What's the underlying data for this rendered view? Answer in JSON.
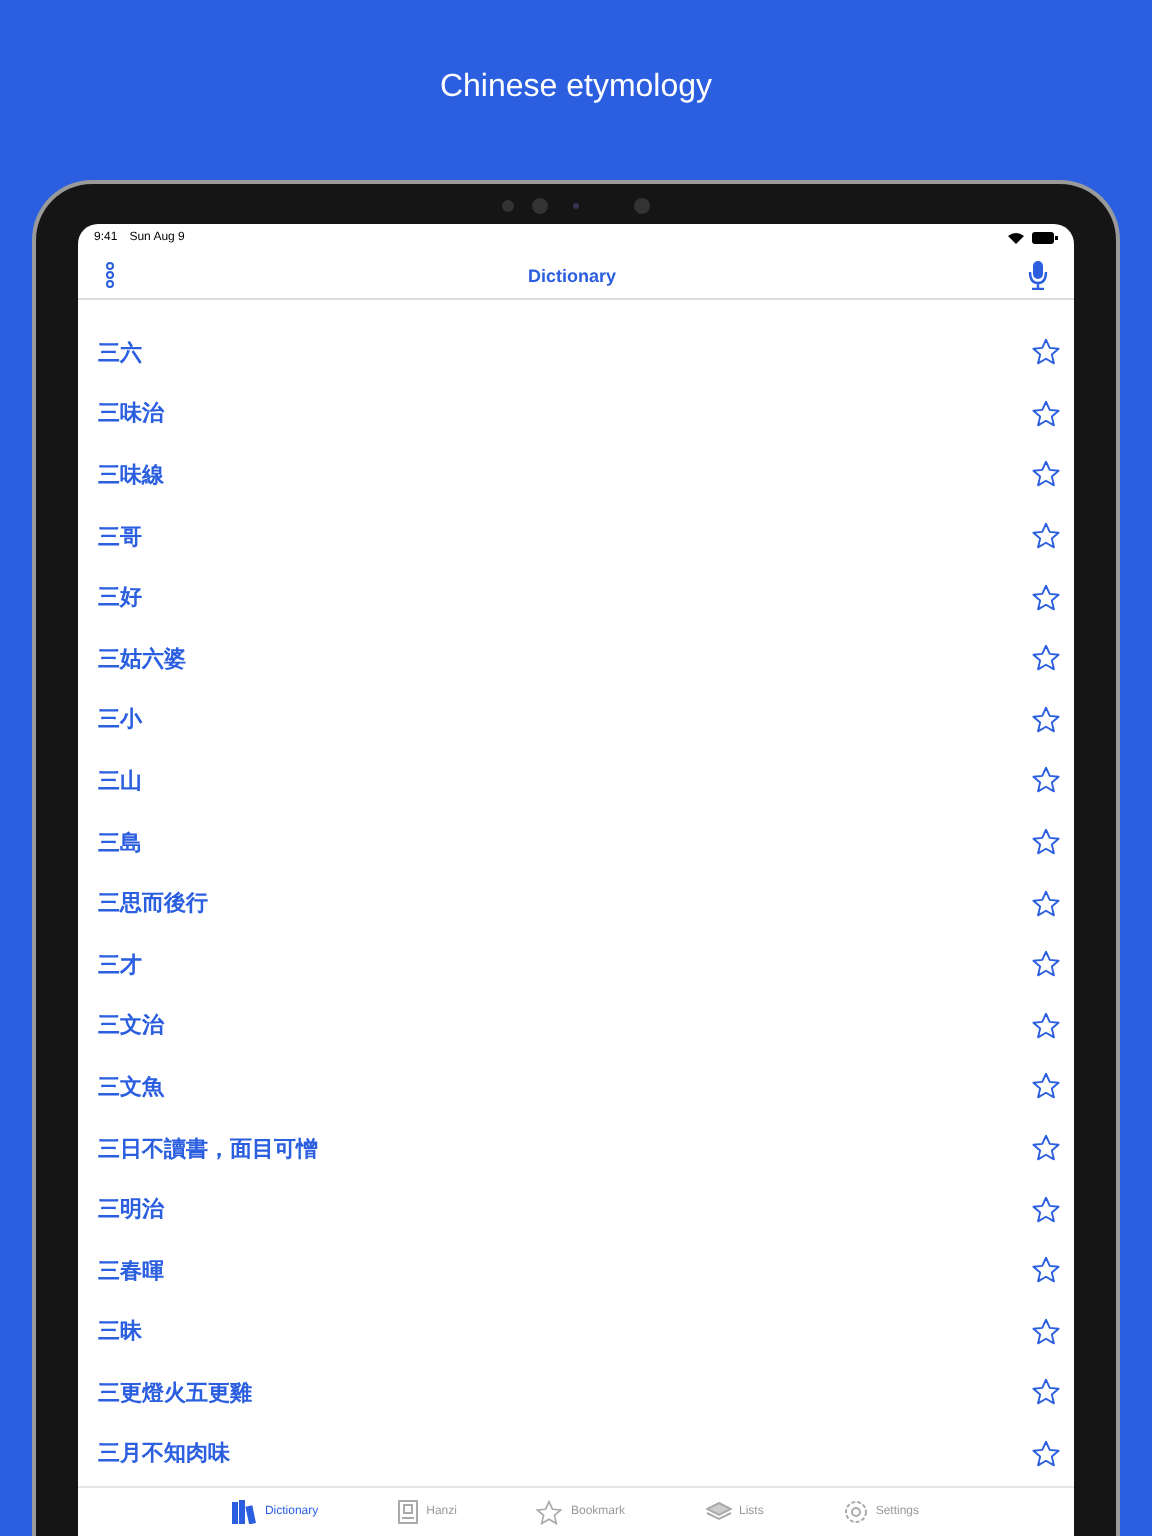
{
  "headline": "Chinese etymology",
  "status_bar": {
    "time": "9:41",
    "date": "Sun Aug 9"
  },
  "nav_bar": {
    "title": "Dictionary"
  },
  "entries": [
    {
      "word": "三六",
      "bookmarked": false
    },
    {
      "word": "三味治",
      "bookmarked": false
    },
    {
      "word": "三味線",
      "bookmarked": false
    },
    {
      "word": "三哥",
      "bookmarked": false
    },
    {
      "word": "三好",
      "bookmarked": false
    },
    {
      "word": "三姑六婆",
      "bookmarked": false
    },
    {
      "word": "三小",
      "bookmarked": false
    },
    {
      "word": "三山",
      "bookmarked": false
    },
    {
      "word": "三島",
      "bookmarked": false
    },
    {
      "word": "三思而後行",
      "bookmarked": false
    },
    {
      "word": "三才",
      "bookmarked": false
    },
    {
      "word": "三文治",
      "bookmarked": false
    },
    {
      "word": "三文魚",
      "bookmarked": false
    },
    {
      "word": "三日不讀書，面目可憎",
      "bookmarked": false
    },
    {
      "word": "三明治",
      "bookmarked": false
    },
    {
      "word": "三春暉",
      "bookmarked": false
    },
    {
      "word": "三昧",
      "bookmarked": false
    },
    {
      "word": "三更燈火五更雞",
      "bookmarked": false
    },
    {
      "word": "三月不知肉味",
      "bookmarked": false
    }
  ],
  "tab_bar": [
    {
      "kind": "books",
      "label": "Dictionary",
      "selected": true
    },
    {
      "kind": "card",
      "label": "Hanzi",
      "selected": false
    },
    {
      "kind": "star",
      "label": "Bookmark",
      "selected": false
    },
    {
      "kind": "layers",
      "label": "Lists",
      "selected": false
    },
    {
      "kind": "gear",
      "label": "Settings",
      "selected": false
    }
  ]
}
